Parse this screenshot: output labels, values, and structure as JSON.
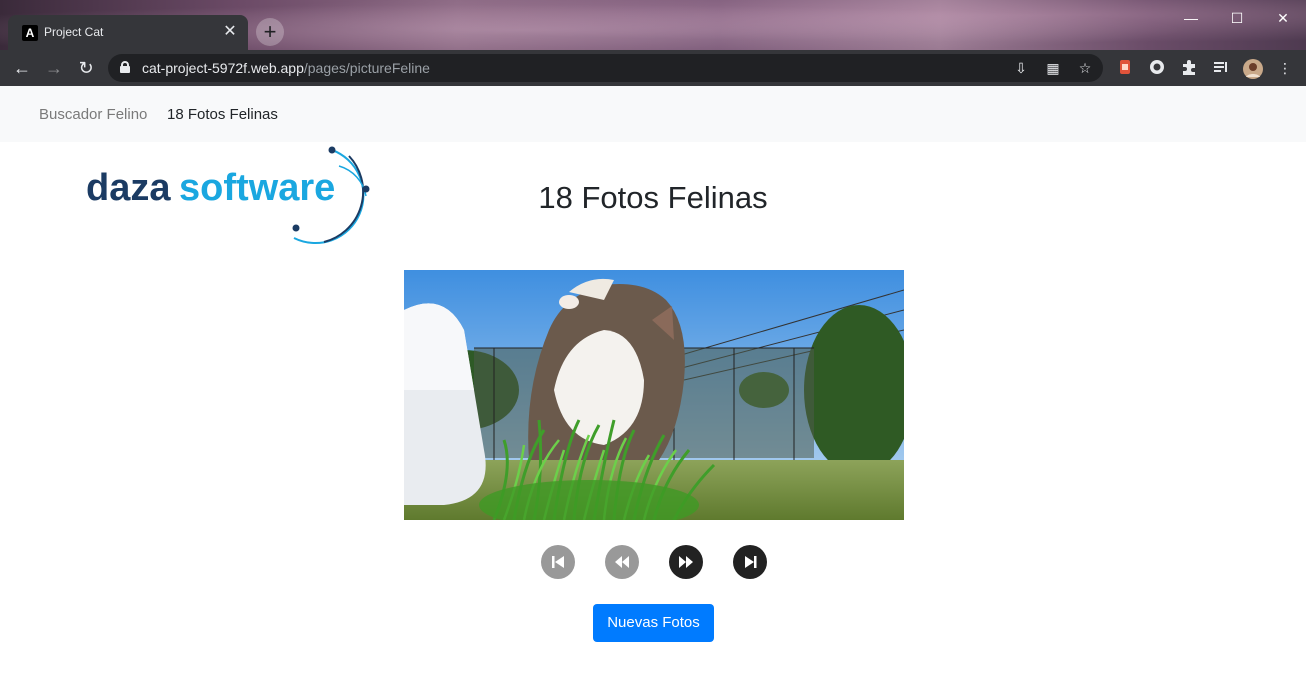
{
  "browser": {
    "tab_title": "Project Cat",
    "tab_favicon_letter": "A",
    "url_host": "cat-project-5972f.web.app",
    "url_path": "/pages/pictureFeline"
  },
  "navbar": {
    "links": [
      {
        "label": "Buscador Felino"
      },
      {
        "label": "18 Fotos Felinas"
      }
    ]
  },
  "logo": {
    "text_dark": "daza",
    "text_light": "software",
    "color_dark": "#1b3b63",
    "color_light": "#1aa7e0"
  },
  "main": {
    "title": "18 Fotos Felinas",
    "new_photos_button": "Nuevas Fotos"
  },
  "colors": {
    "primary": "#007bff",
    "control_disabled": "#999999",
    "control_enabled": "#222222"
  },
  "controls": [
    {
      "icon": "skip-start-icon",
      "enabled": false
    },
    {
      "icon": "rewind-icon",
      "enabled": false
    },
    {
      "icon": "fast-forward-icon",
      "enabled": true
    },
    {
      "icon": "skip-end-icon",
      "enabled": true
    }
  ]
}
